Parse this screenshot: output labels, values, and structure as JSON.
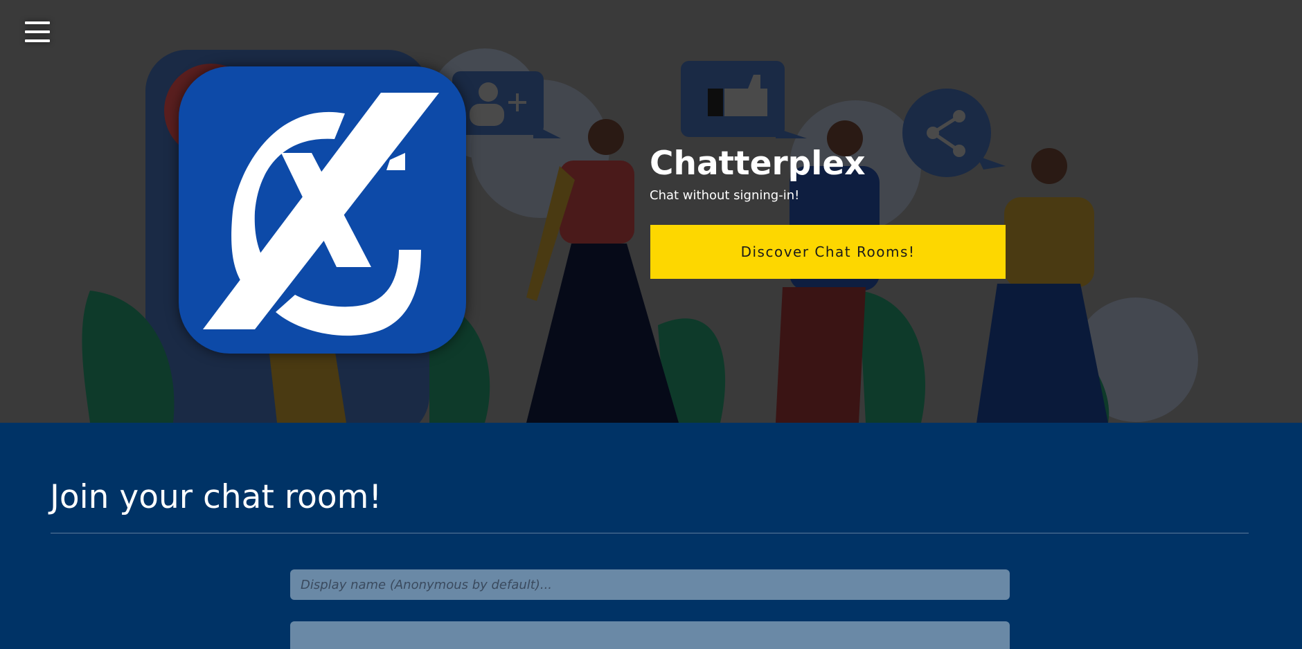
{
  "menu": {
    "icon": "hamburger-menu-icon"
  },
  "hero": {
    "logo_icon": "chatterplex-cx-logo",
    "title": "Chatterplex",
    "tagline": "Chat without signing-in!",
    "discover_button_label": "Discover Chat Rooms!"
  },
  "join": {
    "title": "Join your chat room!",
    "display_name_placeholder": "Display name (Anonymous by default)...",
    "display_name_value": "",
    "second_input_placeholder": ""
  },
  "colors": {
    "hero_bg": "#3a3a3a",
    "logo_bg": "#0d4aa8",
    "accent_button": "#fdd700",
    "section_bg": "#003366",
    "input_bg": "#6a89a6"
  }
}
